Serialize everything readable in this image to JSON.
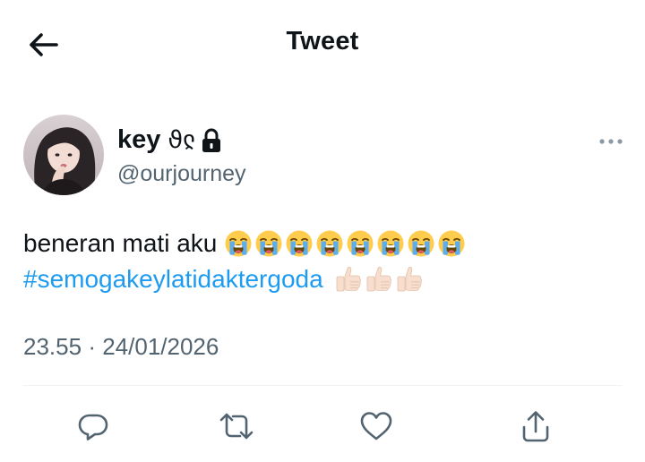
{
  "header": {
    "title": "Tweet",
    "back_icon": "arrow-left-icon"
  },
  "author": {
    "display_name": "key",
    "name_glyph": "ϑჺ",
    "protected_icon": "lock-icon",
    "handle": "@ourjourney",
    "more_icon": "more-horizontal-icon"
  },
  "tweet": {
    "text": "beneran mati aku",
    "text_emoji": "loudly-crying-face",
    "text_emoji_count": 8,
    "hashtag": "#semogakeylatidaktergoda",
    "hashtag_emoji": "thumbs-up-light-skin",
    "hashtag_emoji_count": 3
  },
  "meta": {
    "time": "23.55",
    "separator": "·",
    "date": "24/01/2026"
  },
  "actions": [
    {
      "name": "reply",
      "icon": "reply-icon"
    },
    {
      "name": "retweet",
      "icon": "retweet-icon"
    },
    {
      "name": "like",
      "icon": "heart-icon"
    },
    {
      "name": "share",
      "icon": "share-icon"
    }
  ],
  "colors": {
    "accent": "#1d9bf0",
    "secondary_text": "#536471",
    "primary_text": "#0f1419",
    "divider": "#eff3f4"
  }
}
